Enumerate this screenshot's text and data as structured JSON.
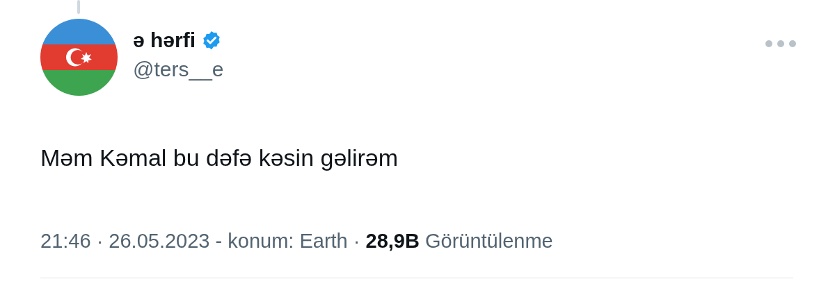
{
  "author": {
    "name": "ə hərfi",
    "verified": true,
    "handle": "@ters__e"
  },
  "tweet": {
    "text": "Məm Kəmal bu dəfə kəsin gəlirəm",
    "meta": "21:46 · 26.05.2023 - konum: Earth · **28,9B** Görüntülenme"
  }
}
